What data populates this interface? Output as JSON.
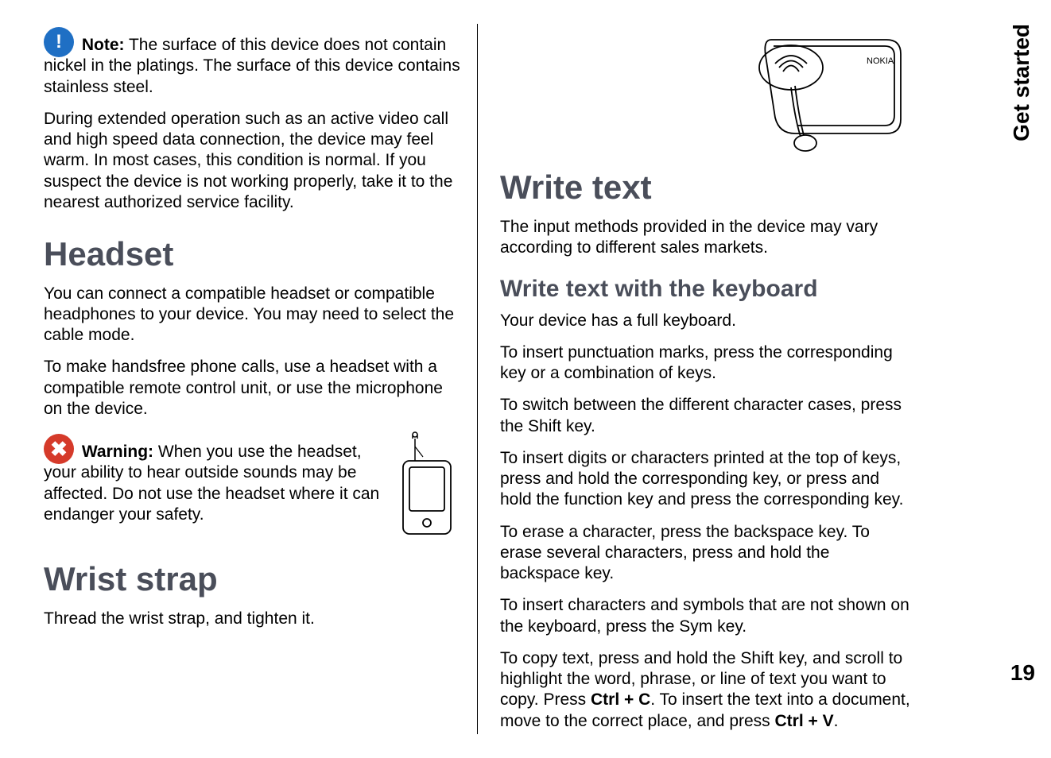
{
  "sideTab": "Get started",
  "pageNumber": "19",
  "left": {
    "noteLabel": "Note:",
    "noteText": "  The surface of this device does not contain nickel in the platings. The surface of this device contains stainless steel.",
    "para2": "During extended operation such as an active video call and high speed data connection, the device may feel warm. In most cases, this condition is normal. If you suspect the device is not working properly, take it to the nearest authorized service facility.",
    "headsetTitle": "Headset",
    "headsetP1": "You can connect a compatible headset or compatible headphones to your device. You may need to select the cable mode.",
    "headsetP2": "To make handsfree phone calls, use a headset with a compatible remote control unit, or use the microphone on the device.",
    "warnLabel": "Warning:",
    "warnText": "  When you use the headset, your ability to hear outside sounds may be affected. Do not use the headset where it can endanger your safety.",
    "wristTitle": "Wrist strap",
    "wristP1": "Thread the wrist strap, and tighten it."
  },
  "right": {
    "writeTitle": "Write text",
    "writeIntro": "The input methods provided in the device may vary according to different sales markets.",
    "kbTitle": "Write text with the keyboard",
    "kbP1": "Your device has a full keyboard.",
    "kbP2": "To insert punctuation marks, press the corresponding key or a combination of keys.",
    "kbP3": "To switch between the different character cases, press the Shift key.",
    "kbP4": "To insert digits or characters printed at the top of keys, press and hold the corresponding key, or press and hold the function key and press the corresponding key.",
    "kbP5": "To erase a character, press the backspace key. To erase several characters, press and hold the backspace key.",
    "kbP6": "To insert characters and symbols that are not shown on the keyboard, press the Sym key.",
    "kbP7a": "To copy text, press and hold the Shift key, and scroll to highlight the word, phrase, or line of text you want to copy. Press ",
    "kbP7b": "Ctrl + C",
    "kbP7c": ". To insert the text into a document, move to the correct place, and press ",
    "kbP7d": "Ctrl + V",
    "kbP7e": "."
  }
}
